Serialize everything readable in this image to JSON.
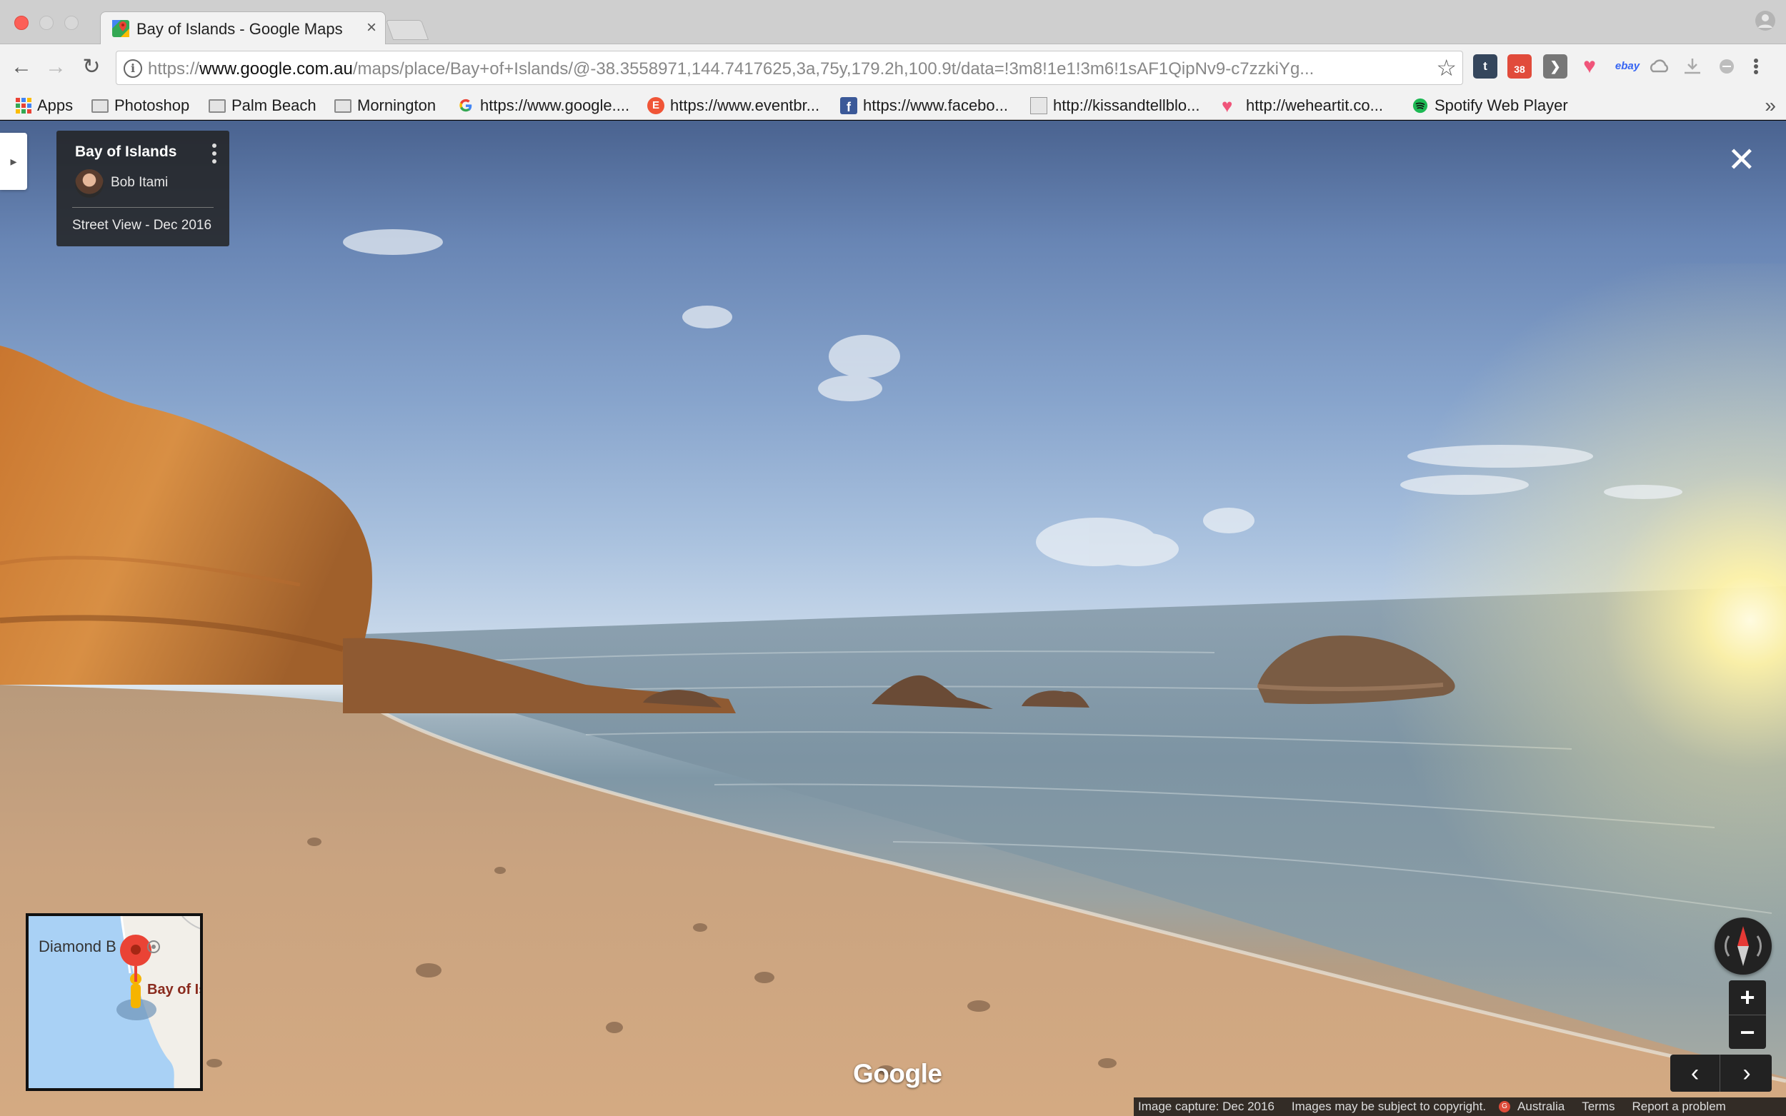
{
  "browser": {
    "tab_title": "Bay of Islands - Google Maps",
    "tab_close": "×",
    "url_prefix": "https://",
    "url_domain": "www.google.com.au",
    "url_path": "/maps/place/Bay+of+Islands/@-38.3558971,144.7417625,3a,75y,179.2h,100.9t/data=!3m8!1e1!3m6!1sAF1QipNv9-c7zzkiYg...",
    "info_glyph": "i",
    "back_glyph": "←",
    "forward_glyph": "→",
    "reload_glyph": "↻",
    "star_glyph": "☆",
    "more_glyph": "»",
    "calendar_badge": "38",
    "extensions": [
      {
        "name": "tumblr",
        "label": "t",
        "color": "#35465c"
      },
      {
        "name": "calendar",
        "label": "38",
        "color": "#e14b3b"
      },
      {
        "name": "pocket",
        "label": "❯",
        "color": "#777777"
      },
      {
        "name": "heart",
        "label": "♥",
        "color": "#f0557a"
      },
      {
        "name": "ebay",
        "label": "ebay",
        "color": "#f5f5f5"
      }
    ],
    "bookmarks": [
      {
        "label": "Apps",
        "icon": "apps-grid-icon"
      },
      {
        "label": "Photoshop",
        "icon": "folder-icon"
      },
      {
        "label": "Palm Beach",
        "icon": "folder-icon"
      },
      {
        "label": "Mornington",
        "icon": "folder-icon"
      },
      {
        "label": "https://www.google....",
        "icon": "google-icon"
      },
      {
        "label": "https://www.eventbr...",
        "icon": "eventbrite-icon"
      },
      {
        "label": "https://www.facebo...",
        "icon": "facebook-icon"
      },
      {
        "label": "http://kissandtellblo...",
        "icon": "page-icon"
      },
      {
        "label": "http://weheartit.co...",
        "icon": "weheartit-icon"
      },
      {
        "label": "Spotify Web Player",
        "icon": "spotify-icon"
      }
    ]
  },
  "street_view": {
    "title": "Bay of Islands",
    "author": "Bob Itami",
    "capture": "Street View - Dec 2016",
    "close_glyph": "✕",
    "side_toggle_glyph": "▸",
    "logo": "Google",
    "zoom_in": "+",
    "zoom_out": "−",
    "prev_glyph": "‹",
    "next_glyph": "›",
    "minimap": {
      "label_diamond_bay": "Diamond B",
      "label_bay_of_islands": "Bay of Is"
    },
    "footer": {
      "image_capture": "Image capture: Dec 2016",
      "copyright": "Images may be subject to copyright.",
      "region": "Australia",
      "terms": "Terms",
      "report": "Report a problem"
    }
  },
  "colors": {
    "accent_red": "#ea4335",
    "map_water": "#a9d1f5",
    "map_land": "#f2efe9",
    "pegman": "#f6b400"
  }
}
